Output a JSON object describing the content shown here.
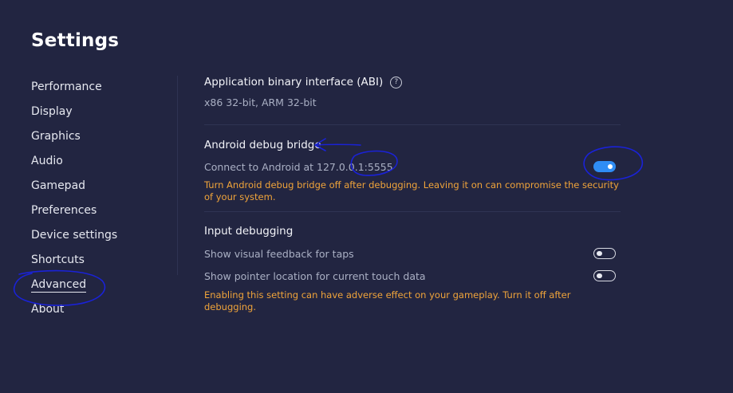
{
  "page_title": "Settings",
  "sidebar": {
    "items": [
      {
        "label": "Performance"
      },
      {
        "label": "Display"
      },
      {
        "label": "Graphics"
      },
      {
        "label": "Audio"
      },
      {
        "label": "Gamepad"
      },
      {
        "label": "Preferences"
      },
      {
        "label": "Device settings"
      },
      {
        "label": "Shortcuts"
      },
      {
        "label": "Advanced",
        "active": true
      },
      {
        "label": "About"
      }
    ]
  },
  "abi": {
    "title": "Application binary interface (ABI)",
    "help_icon": "?",
    "value": "x86 32-bit, ARM 32-bit"
  },
  "adb": {
    "title": "Android debug bridge",
    "description": "Connect to Android at 127.0.0.1:5555",
    "enabled": true,
    "warning": "Turn Android debug bridge off after debugging. Leaving it on can compromise the security of your system."
  },
  "input_debugging": {
    "title": "Input debugging",
    "visual_feedback": {
      "label": "Show visual feedback for taps",
      "enabled": false
    },
    "pointer_location": {
      "label": "Show pointer location for current touch data",
      "enabled": false
    },
    "warning": "Enabling this setting can have adverse effect on your gameplay. Turn it off after  debugging."
  },
  "colors": {
    "background": "#222541",
    "accent": "#2f8df5",
    "warning": "#f0a43a",
    "annotation_ink": "#1a22d8"
  }
}
